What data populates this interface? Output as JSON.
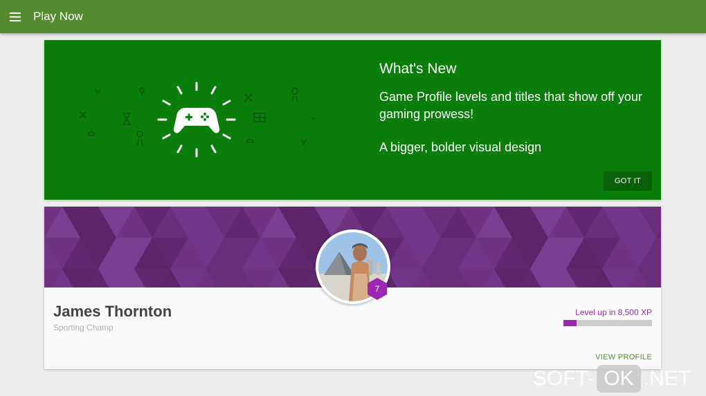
{
  "appbar": {
    "title": "Play Now",
    "icon": "menu-icon",
    "color": "#558b2f"
  },
  "whats_new": {
    "title": "What's New",
    "line1": "Game Profile levels and titles that show off your gaming prowess!",
    "line2": "A bigger, bolder visual design",
    "button": "GOT IT",
    "background": "#0b7d0b",
    "icon": "gamepad-icon"
  },
  "profile": {
    "name": "James Thornton",
    "title": "Sporting Champ",
    "level": "7",
    "levelup_text": "Level up in 8,500 XP",
    "xp_progress": 0.15,
    "view_profile": "VIEW PROFILE",
    "banner_color": "#6a2f7a",
    "accent": "#9c27b0"
  },
  "watermark": {
    "part1": "SOFT-",
    "part2": "OK",
    "part3": ".NET"
  }
}
